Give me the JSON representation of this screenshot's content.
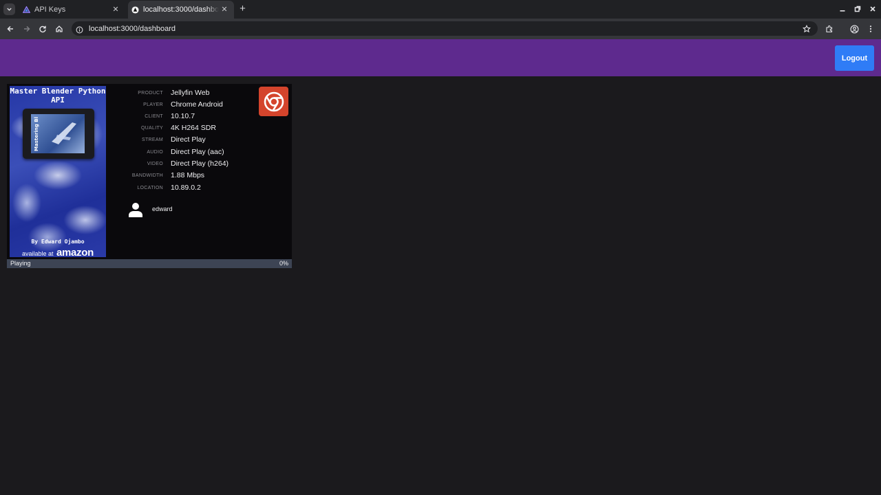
{
  "browser": {
    "tabs": [
      {
        "label": "API Keys",
        "active": false
      },
      {
        "label": "localhost:3000/dashboard",
        "active": true
      }
    ],
    "url": "localhost:3000/dashboard"
  },
  "header": {
    "logout_label": "Logout",
    "bar_color": "#5e2a8e",
    "button_color": "#2f7cf6"
  },
  "session": {
    "poster": {
      "title_line1": "Master Blender Python",
      "title_line2": "API",
      "book_text": "Mastering Blender Python API",
      "author": "By Edward Ojambo",
      "available": "available at",
      "store": "amazon"
    },
    "details": [
      {
        "key": "PRODUCT",
        "value": "Jellyfin Web"
      },
      {
        "key": "PLAYER",
        "value": "Chrome Android"
      },
      {
        "key": "CLIENT",
        "value": "10.10.7"
      },
      {
        "key": "QUALITY",
        "value": "4K H264 SDR"
      },
      {
        "key": "STREAM",
        "value": "Direct Play"
      },
      {
        "key": "AUDIO",
        "value": "Direct Play (aac)"
      },
      {
        "key": "VIDEO",
        "value": "Direct Play (h264)"
      },
      {
        "key": "BANDWIDTH",
        "value": "1.88 Mbps"
      },
      {
        "key": "LOCATION",
        "value": "10.89.0.2"
      }
    ],
    "client_icon": "chrome-icon",
    "user": "edward",
    "status": "Playing",
    "progress_text": "0%",
    "progress_fraction": 0.0
  }
}
